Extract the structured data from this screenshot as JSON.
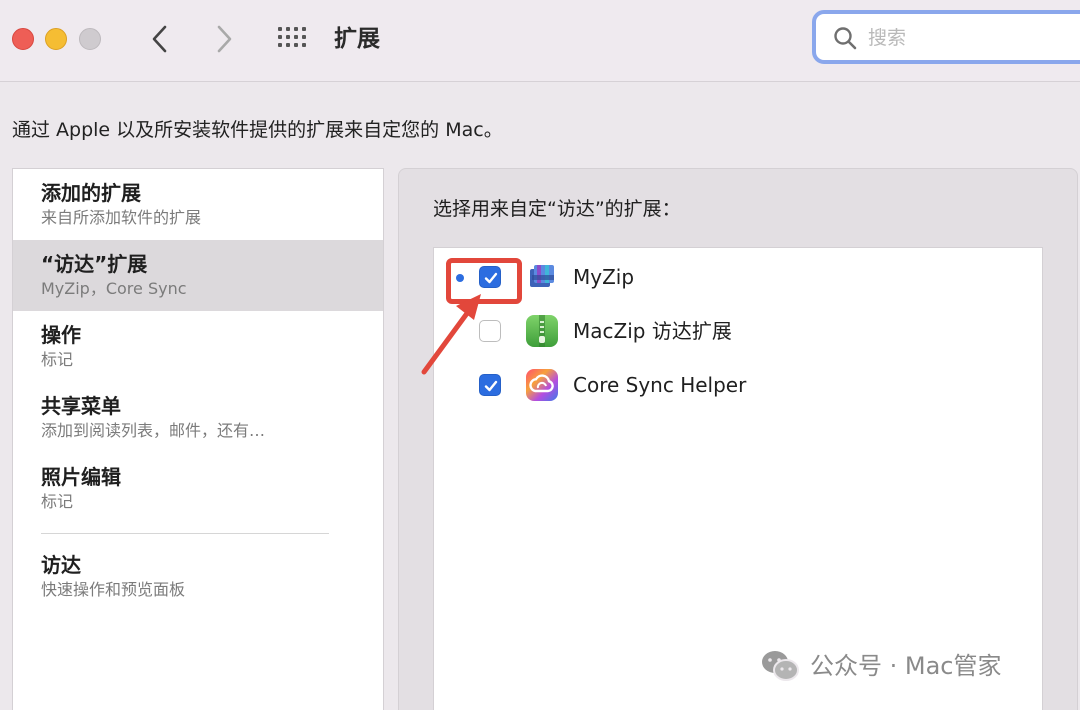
{
  "window": {
    "title": "扩展",
    "search_placeholder": "搜索"
  },
  "description": "通过 Apple 以及所安装软件提供的扩展来自定您的 Mac。",
  "sidebar": {
    "items": [
      {
        "title": "添加的扩展",
        "subtitle": "来自所添加软件的扩展",
        "selected": false
      },
      {
        "title": "“访达”扩展",
        "subtitle": "MyZip，Core Sync",
        "selected": true
      },
      {
        "title": "操作",
        "subtitle": "标记",
        "selected": false
      },
      {
        "title": "共享菜单",
        "subtitle": "添加到阅读列表，邮件，还有…",
        "selected": false
      },
      {
        "title": "照片编辑",
        "subtitle": "标记",
        "selected": false
      },
      {
        "title": "访达",
        "subtitle": "快速操作和预览面板",
        "selected": false
      }
    ]
  },
  "panel": {
    "title": "选择用来自定“访达”的扩展：",
    "extensions": [
      {
        "name": "MyZip",
        "checked": true,
        "icon": "myzip-app-icon"
      },
      {
        "name": "MacZip 访达扩展",
        "checked": false,
        "icon": "maczip-app-icon"
      },
      {
        "name": "Core Sync Helper",
        "checked": true,
        "icon": "core-sync-app-icon"
      }
    ]
  },
  "watermark": {
    "text": "公众号 · Mac管家"
  },
  "colors": {
    "accent": "#2c6de0",
    "annotation": "#e2473b",
    "search_focus": "#8aa7ec"
  }
}
